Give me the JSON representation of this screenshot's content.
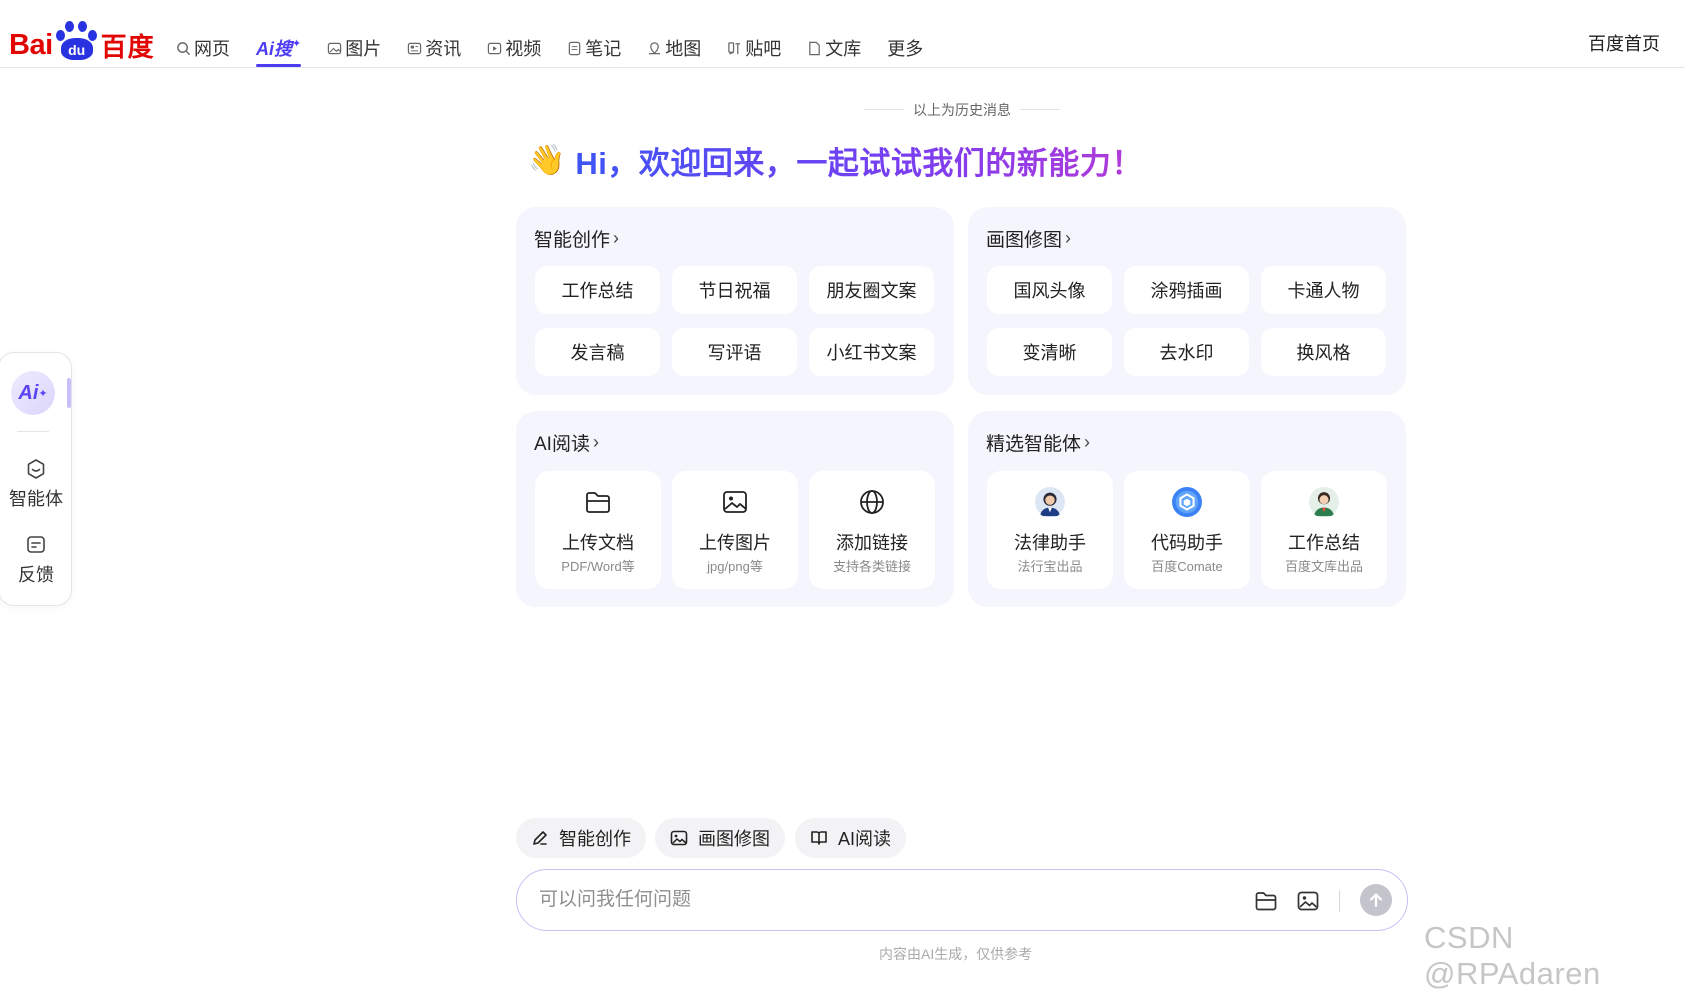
{
  "logo": {
    "latin": "Bai",
    "mark": "du",
    "chinese": "百度"
  },
  "nav": {
    "tabs": [
      {
        "label": "网页",
        "icon": "search-icon"
      },
      {
        "label": "Ai搜",
        "icon": "ai-search-icon",
        "active": true
      },
      {
        "label": "图片",
        "icon": "image-icon"
      },
      {
        "label": "资讯",
        "icon": "news-icon"
      },
      {
        "label": "视频",
        "icon": "video-icon"
      },
      {
        "label": "笔记",
        "icon": "note-icon"
      },
      {
        "label": "地图",
        "icon": "map-icon"
      },
      {
        "label": "贴吧",
        "icon": "tieba-icon"
      },
      {
        "label": "文库",
        "icon": "wenku-icon"
      },
      {
        "label": "更多",
        "icon": ""
      }
    ],
    "home": "百度首页"
  },
  "rail": {
    "ai_label": "Ai",
    "items": [
      {
        "label": "智能体",
        "icon": "agent-icon"
      },
      {
        "label": "反馈",
        "icon": "feedback-icon"
      }
    ]
  },
  "history_notice": "以上为历史消息",
  "welcome": {
    "emoji": "👋",
    "text": "Hi，欢迎回来，一起试试我们的新能力！"
  },
  "cards": {
    "creation": {
      "title": "智能创作",
      "items": [
        "工作总结",
        "节日祝福",
        "朋友圈文案",
        "发言稿",
        "写评语",
        "小红书文案"
      ]
    },
    "painting": {
      "title": "画图修图",
      "items": [
        "国风头像",
        "涂鸦插画",
        "卡通人物",
        "变清晰",
        "去水印",
        "换风格"
      ]
    },
    "reading": {
      "title": "AI阅读",
      "tiles": [
        {
          "label": "上传文档",
          "sub": "PDF/Word等",
          "icon": "folder-icon"
        },
        {
          "label": "上传图片",
          "sub": "jpg/png等",
          "icon": "image-upload-icon"
        },
        {
          "label": "添加链接",
          "sub": "支持各类链接",
          "icon": "globe-icon"
        }
      ]
    },
    "agents": {
      "title": "精选智能体",
      "tiles": [
        {
          "label": "法律助手",
          "sub": "法行宝出品",
          "icon": "lawyer-avatar-icon"
        },
        {
          "label": "代码助手",
          "sub": "百度Comate",
          "icon": "comate-logo-icon"
        },
        {
          "label": "工作总结",
          "sub": "百度文库出品",
          "icon": "worker-avatar-icon"
        }
      ]
    }
  },
  "chips": [
    {
      "label": "智能创作",
      "icon": "pen-icon"
    },
    {
      "label": "画图修图",
      "icon": "picture-edit-icon"
    },
    {
      "label": "AI阅读",
      "icon": "book-icon"
    }
  ],
  "input": {
    "placeholder": "可以问我任何问题",
    "value": ""
  },
  "disclaimer": "内容由AI生成，仅供参考",
  "watermark": "CSDN @RPAdaren",
  "colors": {
    "brand_red": "#e10601",
    "brand_blue": "#2932e1",
    "accent": "#4e3cf5",
    "card_bg": "#f5f6fd"
  }
}
